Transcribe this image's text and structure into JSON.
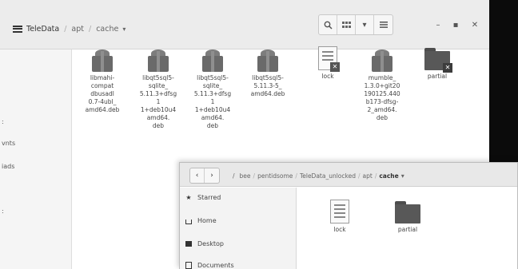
{
  "back_window": {
    "breadcrumb": [
      "TeleData",
      "apt",
      "cache"
    ],
    "toolbar": {
      "search_icon": "search-icon",
      "view_icon": "grid-view-icon",
      "sort_icon": "chevron-down-icon",
      "menu_icon": "hamburger-menu-icon"
    },
    "window_controls": {
      "minimize": "–",
      "maximize": "▪",
      "close": "✕"
    },
    "sidebar_items": [
      {
        "label": ":"
      },
      {
        "label": "vnts"
      },
      {
        "label": "iads"
      },
      {
        "label": ":"
      }
    ],
    "files": [
      {
        "name": "libmahi-compat-dbus-al-0.7-4ubl_amd64.deb",
        "label_lines": [
          "libmahi-",
          "compat",
          "dbusadl",
          "0.7-4ubl_",
          "amd64.deb"
        ],
        "icon": "package-icon"
      },
      {
        "name": "libqt5sql5-sqlite_5.11.3+dfsg-1+deb10u4_amd64.deb",
        "label_lines": [
          "libqt5sql5-",
          "sqlite_",
          "5.11.3+dfsg",
          "1",
          "1+deb10u4",
          "amd64.",
          "deb"
        ],
        "icon": "package-icon"
      },
      {
        "name": "libqt5sql5-sqlite_5.11.3+dfsg-1+deb10u4_amd64.deb",
        "label_lines": [
          "libqt5sql5-",
          "sqlite_",
          "5.11.3+dfsg",
          "1",
          "1+deb10u4",
          "amd64.",
          "deb"
        ],
        "icon": "package-icon"
      },
      {
        "name": "libqt5sql5_5.11.3_amd64.deb",
        "label_lines": [
          "libqt5sql5-",
          "5.11.3-5_",
          "amd64.deb"
        ],
        "icon": "package-icon"
      },
      {
        "name": "lock",
        "label_lines": [
          "lock"
        ],
        "icon": "locked-file-icon"
      },
      {
        "name": "mumble_1.3.0+git20190125.440b173-2_amd64.deb",
        "label_lines": [
          "mumble_",
          "1.3.0+git20",
          "190125.440",
          "b173-dfsg-",
          "2_amd64.",
          "deb"
        ],
        "icon": "package-icon"
      },
      {
        "name": "partial",
        "label_lines": [
          "partial"
        ],
        "icon": "locked-folder-icon"
      }
    ]
  },
  "front_window": {
    "nav": {
      "back": "‹",
      "forward": "›"
    },
    "path": [
      "/",
      "bee",
      "pentidsome",
      "TeleData_unlocked",
      "apt",
      "cache"
    ],
    "sidebar_items": [
      {
        "label": "Starred",
        "icon": "star-icon"
      },
      {
        "label": "Home",
        "icon": "home-icon"
      },
      {
        "label": "Desktop",
        "icon": "desktop-icon"
      },
      {
        "label": "Documents",
        "icon": "documents-icon"
      }
    ],
    "files": [
      {
        "name": "lock",
        "icon": "text-file-icon"
      },
      {
        "name": "partial",
        "icon": "folder-icon"
      }
    ]
  }
}
